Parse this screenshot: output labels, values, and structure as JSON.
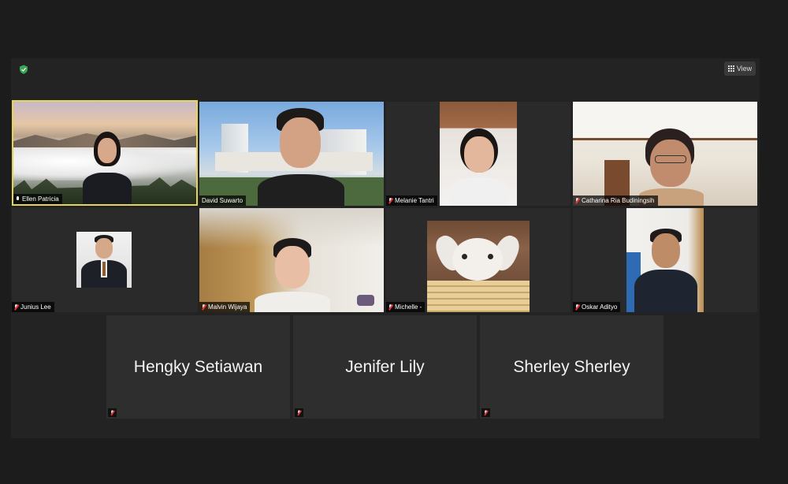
{
  "toolbar": {
    "view_label": "View"
  },
  "participants": [
    {
      "name": "Ellen Patricia"
    },
    {
      "name": "David Suwarto"
    },
    {
      "name": "Melanie Tantri"
    },
    {
      "name": "Catharina Ria Budiningsih"
    },
    {
      "name": "Junius Lee"
    },
    {
      "name": "Malvin Wijaya"
    },
    {
      "name": "Michelle -"
    },
    {
      "name": "Oskar Adityo"
    },
    {
      "name": "Hengky Setiawan"
    },
    {
      "name": "Jenifer Lily"
    },
    {
      "name": "Sherley Sherley"
    }
  ],
  "colors": {
    "active_speaker_border": "#e6d35c",
    "muted_icon": "#e33",
    "background": "#1c1c1c"
  },
  "icons": {
    "security": "shield-icon",
    "view": "grid-icon",
    "mic_muted": "mic-muted-icon",
    "mic_on": "mic-icon"
  }
}
